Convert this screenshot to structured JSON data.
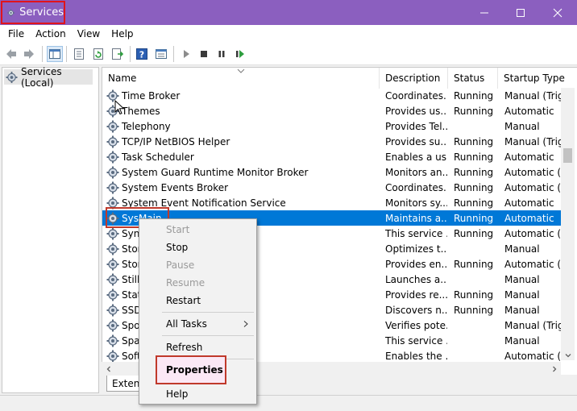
{
  "window": {
    "title": "Services",
    "controls": [
      "minimize-icon",
      "maximize-icon",
      "close-icon"
    ],
    "title_bar_color": "#8b5fbf"
  },
  "menubar": {
    "items": [
      "File",
      "Action",
      "View",
      "Help"
    ]
  },
  "toolbar": {
    "icons": [
      "back-icon",
      "forward-icon",
      "show-hide-tree-icon",
      "export-list-icon",
      "refresh-icon",
      "export-icon",
      "help-icon",
      "properties-icon",
      "start-service-icon",
      "stop-service-icon",
      "pause-service-icon",
      "restart-service-icon"
    ]
  },
  "tree": {
    "root_label": "Services (Local)"
  },
  "table": {
    "columns": [
      "Name",
      "Description",
      "Status",
      "Startup Type"
    ],
    "rows": [
      {
        "name": "Time Broker",
        "description": "Coordinates...",
        "status": "Running",
        "startup": "Manual (Trig..."
      },
      {
        "name": "Themes",
        "description": "Provides us...",
        "status": "Running",
        "startup": "Automatic"
      },
      {
        "name": "Telephony",
        "description": "Provides Tel...",
        "status": "",
        "startup": "Manual"
      },
      {
        "name": "TCP/IP NetBIOS Helper",
        "description": "Provides su...",
        "status": "Running",
        "startup": "Manual (Trig..."
      },
      {
        "name": "Task Scheduler",
        "description": "Enables a us...",
        "status": "Running",
        "startup": "Automatic"
      },
      {
        "name": "System Guard Runtime Monitor Broker",
        "description": "Monitors an...",
        "status": "Running",
        "startup": "Automatic (..."
      },
      {
        "name": "System Events Broker",
        "description": "Coordinates...",
        "status": "Running",
        "startup": "Automatic (T..."
      },
      {
        "name": "System Event Notification Service",
        "description": "Monitors sy...",
        "status": "Running",
        "startup": "Automatic"
      },
      {
        "name": "SysMain",
        "description": "Maintains a...",
        "status": "Running",
        "startup": "Automatic",
        "selected": true
      },
      {
        "name": "Sync",
        "description": "This service ...",
        "status": "Running",
        "startup": "Automatic (..."
      },
      {
        "name": "Stor",
        "description": "Optimizes t...",
        "status": "",
        "startup": "Manual"
      },
      {
        "name": "Stor",
        "description": "Provides en...",
        "status": "Running",
        "startup": "Automatic (..."
      },
      {
        "name": "Still",
        "description": "Launches a...",
        "status": "",
        "startup": "Manual"
      },
      {
        "name": "Stat",
        "description": "Provides re...",
        "status": "Running",
        "startup": "Manual"
      },
      {
        "name": "SSD",
        "description": "Discovers n...",
        "status": "Running",
        "startup": "Manual"
      },
      {
        "name": "Spo",
        "description": "Verifies pote...",
        "status": "",
        "startup": "Manual (Trig..."
      },
      {
        "name": "Spat",
        "description": "This service ...",
        "status": "",
        "startup": "Manual"
      },
      {
        "name": "Soft",
        "description": "Enables the ...",
        "status": "",
        "startup": "Automatic (..."
      }
    ]
  },
  "tabs": {
    "extended": "Extende"
  },
  "context_menu": {
    "start": "Start",
    "stop": "Stop",
    "pause": "Pause",
    "resume": "Resume",
    "restart": "Restart",
    "all_tasks": "All Tasks",
    "refresh": "Refresh",
    "properties": "Properties",
    "help": "Help"
  },
  "colors": {
    "selection": "#0078d7",
    "highlight_box": "#c0392b"
  }
}
